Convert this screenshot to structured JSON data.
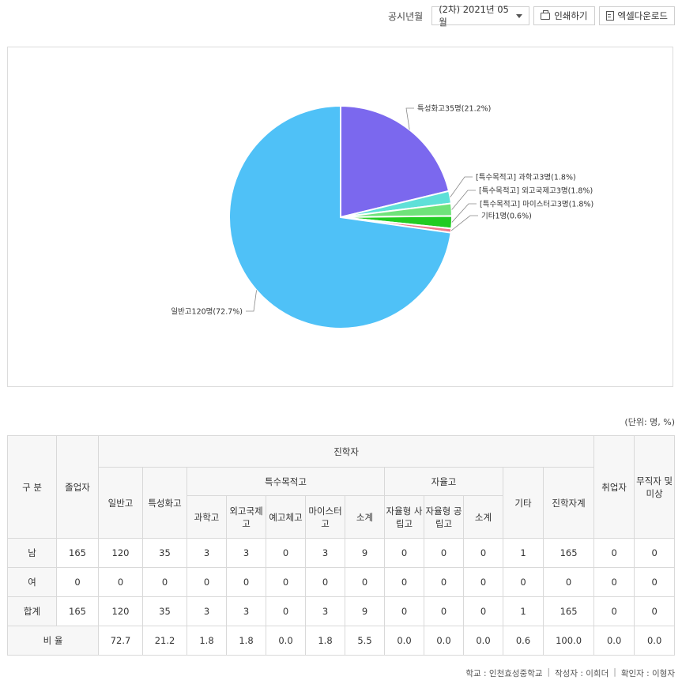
{
  "toolbar": {
    "period_label": "공시년월",
    "period_value": "(2차) 2021년 05월",
    "print_label": "인쇄하기",
    "excel_label": "엑셀다운로드"
  },
  "chart_data": {
    "type": "pie",
    "slices": [
      {
        "label": "특성화고35명(21.2%)",
        "value": 21.2,
        "color": "#7b68ee"
      },
      {
        "label": "[특수목적고] 과학고3명(1.8%)",
        "value": 1.8,
        "color": "#5ee0d8"
      },
      {
        "label": "[특수목적고] 외고국제고3명(1.8%)",
        "value": 1.8,
        "color": "#6fe37a"
      },
      {
        "label": "[특수목적고] 마이스터고3명(1.8%)",
        "value": 1.8,
        "color": "#22cc22"
      },
      {
        "label": "기타1명(0.6%)",
        "value": 0.6,
        "color": "#f07a8c"
      },
      {
        "label": "일반고120명(72.7%)",
        "value": 72.7,
        "color": "#4fc1f7"
      }
    ]
  },
  "unit_note": "(단위: 명, %)",
  "table": {
    "h_category": "구 분",
    "h_graduates": "졸업자",
    "h_advance": "진학자",
    "h_general": "일반고",
    "h_special": "특성화고",
    "h_purpose": "특수목적고",
    "h_autonomous": "자율고",
    "h_other": "기타",
    "h_advance_total": "진학자계",
    "h_employed": "취업자",
    "h_unemployed": "무직자 및 미상",
    "h_science": "과학고",
    "h_foreign": "외고국제고",
    "h_arts": "예고체고",
    "h_meister": "마이스터고",
    "h_subtotal1": "소계",
    "h_private": "자율형 사립고",
    "h_public": "자율형 공립고",
    "h_subtotal2": "소계",
    "rows": [
      {
        "label": "남",
        "cells": [
          "165",
          "120",
          "35",
          "3",
          "3",
          "0",
          "3",
          "9",
          "0",
          "0",
          "0",
          "1",
          "165",
          "0",
          "0"
        ]
      },
      {
        "label": "여",
        "cells": [
          "0",
          "0",
          "0",
          "0",
          "0",
          "0",
          "0",
          "0",
          "0",
          "0",
          "0",
          "0",
          "0",
          "0",
          "0"
        ]
      },
      {
        "label": "합계",
        "cells": [
          "165",
          "120",
          "35",
          "3",
          "3",
          "0",
          "3",
          "9",
          "0",
          "0",
          "0",
          "1",
          "165",
          "0",
          "0"
        ]
      }
    ],
    "ratio_label": "비 율",
    "ratio_cells": [
      "72.7",
      "21.2",
      "1.8",
      "1.8",
      "0.0",
      "1.8",
      "5.5",
      "0.0",
      "0.0",
      "0.0",
      "0.6",
      "100.0",
      "0.0",
      "0.0"
    ]
  },
  "footer": {
    "school": "학교 : 인천효성중학교",
    "writer": "작성자 : 이희더",
    "checker": "확인자 : 이형자"
  }
}
